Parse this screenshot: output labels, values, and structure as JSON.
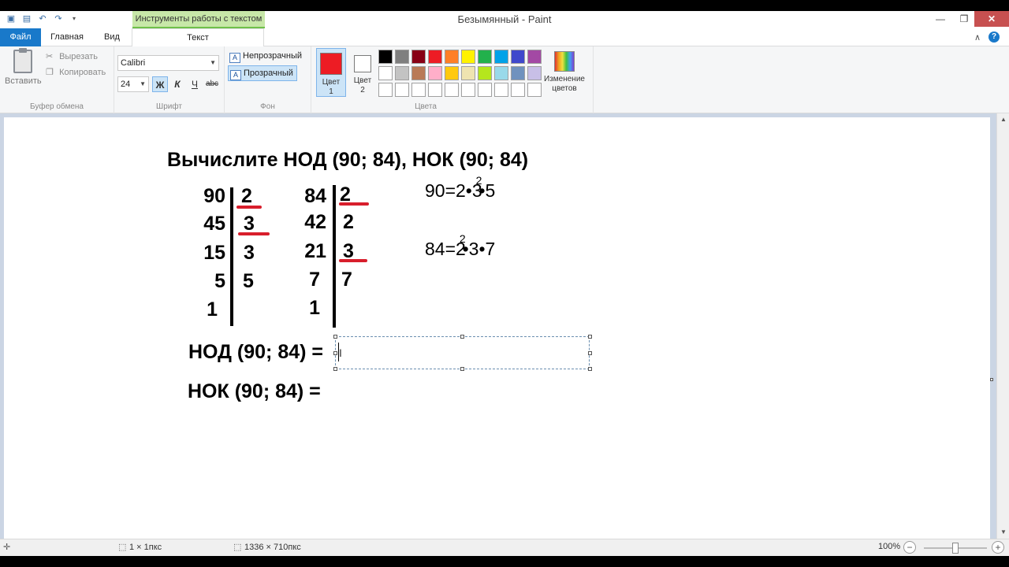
{
  "window": {
    "title": "Безымянный - Paint",
    "context_tab_header": "Инструменты работы с текстом"
  },
  "tabs": {
    "file": "Файл",
    "home": "Главная",
    "view": "Вид",
    "text": "Текст"
  },
  "clipboard": {
    "paste": "Вставить",
    "cut": "Вырезать",
    "copy": "Копировать",
    "label": "Буфер обмена"
  },
  "font": {
    "family": "Calibri",
    "size": "24",
    "bold": "Ж",
    "italic": "К",
    "underline": "Ч",
    "strike": "abc",
    "label": "Шрифт"
  },
  "background": {
    "opaque": "Непрозрачный",
    "transparent": "Прозрачный",
    "label": "Фон"
  },
  "colors": {
    "color1_label_line1": "Цвет",
    "color1_label_line2": "1",
    "color2_label_line1": "Цвет",
    "color2_label_line2": "2",
    "color1": "#ed1c24",
    "color2": "#ffffff",
    "edit_line1": "Изменение",
    "edit_line2": "цветов",
    "label": "Цвета",
    "palette": [
      "#000000",
      "#7f7f7f",
      "#880015",
      "#ed1c24",
      "#ff7f27",
      "#fff200",
      "#22b14c",
      "#00a2e8",
      "#3f48cc",
      "#a349a4",
      "#ffffff",
      "#c3c3c3",
      "#b97a57",
      "#ffaec9",
      "#ffc90e",
      "#efe4b0",
      "#b5e61d",
      "#99d9ea",
      "#7092be",
      "#c8bfe7",
      "#ffffff",
      "#ffffff",
      "#ffffff",
      "#ffffff",
      "#ffffff",
      "#ffffff",
      "#ffffff",
      "#ffffff",
      "#ffffff",
      "#ffffff"
    ]
  },
  "canvas": {
    "heading": "Вычислите НОД (90; 84), НОК (90; 84)",
    "col1_left": [
      "90",
      "45",
      "15",
      "5",
      "1"
    ],
    "col1_right": [
      "2",
      "3",
      "3",
      "5"
    ],
    "col2_left": [
      "84",
      "42",
      "21",
      "7",
      "1"
    ],
    "col2_right": [
      "2",
      "2",
      "3",
      "7"
    ],
    "f1": {
      "pre": "90=2•3",
      "sup": "2",
      "post": "•5"
    },
    "f2": {
      "pre": "84=2",
      "sup": "2",
      "post": "•3•7"
    },
    "gcd_line": "НОД (90; 84) =",
    "lcm_line": "НОК (90; 84) ="
  },
  "status": {
    "selection_size": "1 × 1пкс",
    "image_size": "1336 × 710пкс",
    "zoom": "100%"
  }
}
